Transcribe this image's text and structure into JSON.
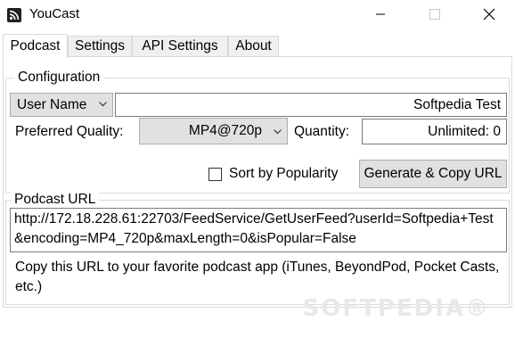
{
  "window": {
    "title": "YouCast"
  },
  "tabs": [
    {
      "label": "Podcast"
    },
    {
      "label": "Settings"
    },
    {
      "label": "API Settings"
    },
    {
      "label": "About"
    }
  ],
  "configuration": {
    "group_label": "Configuration",
    "user_name_combo": "User Name",
    "user_name_value": "Softpedia Test",
    "preferred_quality_label": "Preferred Quality:",
    "preferred_quality_value": "MP4@720p",
    "quantity_label": "Quantity:",
    "quantity_value": "Unlimited: 0",
    "sort_checkbox_label": "Sort by Popularity",
    "sort_checked": false,
    "generate_button": "Generate & Copy URL"
  },
  "podcast_url": {
    "group_label": "Podcast URL",
    "url": "http://172.18.228.61:22703/FeedService/GetUserFeed?userId=Softpedia+Test&encoding=MP4_720p&maxLength=0&isPopular=False",
    "description": "Copy this URL to your favorite podcast app (iTunes, BeyondPod, Pocket Casts, etc.)"
  },
  "watermark": "SOFTPEDIA®",
  "icons": {
    "app": "rss-feed-icon",
    "minimize": "minimize-icon",
    "maximize": "maximize-icon",
    "close": "close-icon",
    "chevron": "chevron-down-icon"
  }
}
